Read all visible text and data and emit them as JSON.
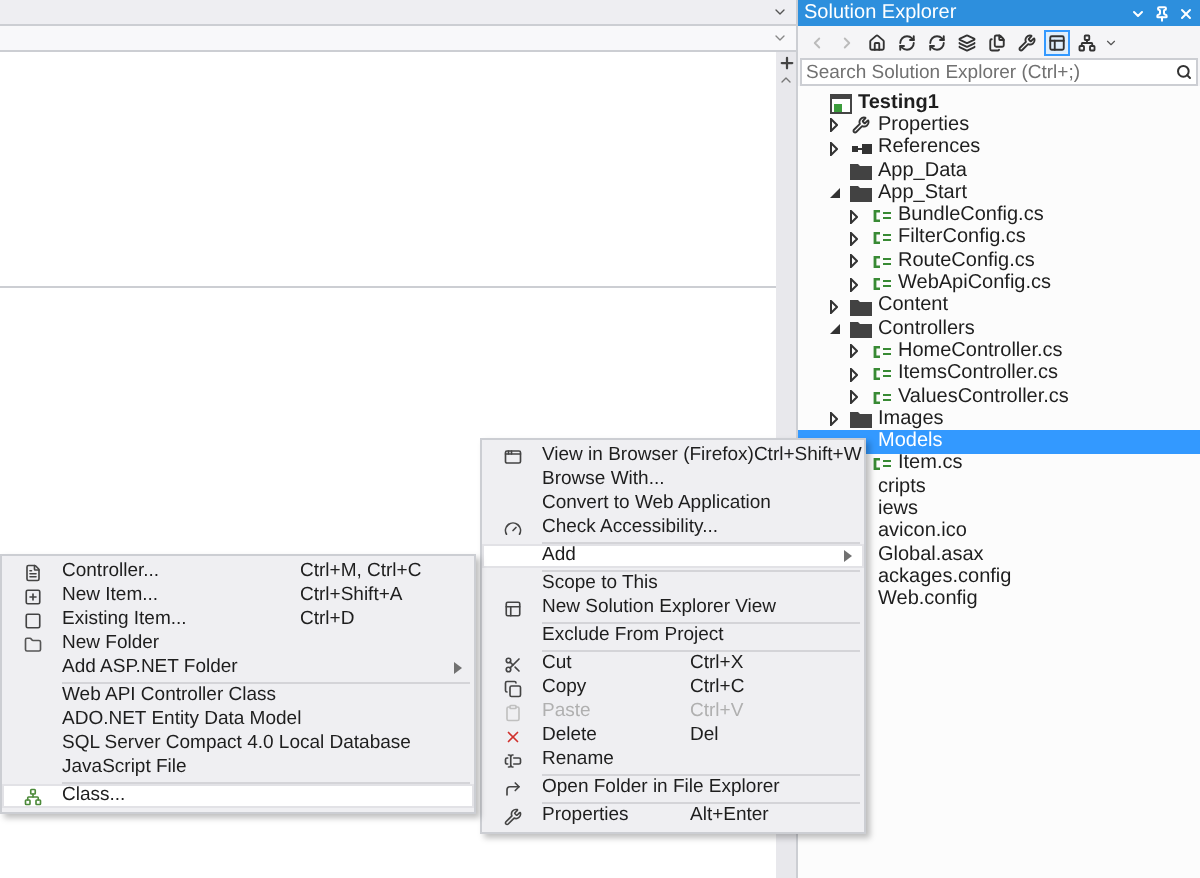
{
  "solution_explorer": {
    "title": "Solution Explorer",
    "toolbar": [
      {
        "kind": "back",
        "selected": false,
        "disabled": true
      },
      {
        "kind": "forward",
        "selected": false,
        "disabled": true
      },
      {
        "kind": "home",
        "selected": false,
        "disabled": false
      },
      {
        "kind": "sync",
        "selected": false,
        "disabled": false
      },
      {
        "kind": "refresh",
        "selected": false,
        "disabled": false
      },
      {
        "kind": "collapse",
        "selected": false,
        "disabled": false
      },
      {
        "kind": "show-all",
        "selected": false,
        "disabled": false
      },
      {
        "kind": "properties",
        "selected": false,
        "disabled": false
      },
      {
        "kind": "preview",
        "selected": true,
        "disabled": false
      },
      {
        "kind": "class-view",
        "selected": false,
        "disabled": false
      }
    ],
    "search": {
      "placeholder": "Search Solution Explorer (Ctrl+;)"
    },
    "tree": [
      {
        "label": "Testing1",
        "kind": "project",
        "selected": false,
        "children": [
          {
            "label": "Properties",
            "kind": "wrench",
            "expanded": false,
            "selected": false
          },
          {
            "label": "References",
            "kind": "references",
            "expanded": false,
            "selected": false
          },
          {
            "label": "App_Data",
            "kind": "folder",
            "selected": false
          },
          {
            "label": "App_Start",
            "kind": "folder",
            "expanded": true,
            "selected": false,
            "children": [
              {
                "label": "BundleConfig.cs",
                "kind": "cs",
                "expanded": false,
                "selected": false
              },
              {
                "label": "FilterConfig.cs",
                "kind": "cs",
                "expanded": false,
                "selected": false
              },
              {
                "label": "RouteConfig.cs",
                "kind": "cs",
                "expanded": false,
                "selected": false
              },
              {
                "label": "WebApiConfig.cs",
                "kind": "cs",
                "expanded": false,
                "selected": false
              }
            ]
          },
          {
            "label": "Content",
            "kind": "folder",
            "expanded": false,
            "selected": false
          },
          {
            "label": "Controllers",
            "kind": "folder",
            "expanded": true,
            "selected": false,
            "children": [
              {
                "label": "HomeController.cs",
                "kind": "cs",
                "expanded": false,
                "selected": false
              },
              {
                "label": "ItemsController.cs",
                "kind": "cs",
                "expanded": false,
                "selected": false
              },
              {
                "label": "ValuesController.cs",
                "kind": "cs",
                "expanded": false,
                "selected": false
              }
            ]
          },
          {
            "label": "Images",
            "kind": "folder",
            "expanded": false,
            "selected": false
          },
          {
            "label": "Models",
            "kind": "plain",
            "selected": true,
            "children": [
              {
                "label": "Item.cs",
                "kind": "cs",
                "selected": false
              }
            ]
          },
          {
            "label": "cripts",
            "kind": "plain",
            "selected": false
          },
          {
            "label": "iews",
            "kind": "plain",
            "selected": false
          },
          {
            "label": "avicon.ico",
            "kind": "plain",
            "selected": false
          },
          {
            "label": "Global.asax",
            "kind": "plain",
            "selected": false
          },
          {
            "label": "ackages.config",
            "kind": "plain",
            "selected": false
          },
          {
            "label": "Web.config",
            "kind": "plain",
            "selected": false
          }
        ]
      }
    ]
  },
  "context_menu": {
    "groups": [
      [
        {
          "kind": "browser",
          "label": "View in Browser (Firefox)",
          "shortcut": "Ctrl+Shift+W",
          "selected": false,
          "disabled": false
        },
        {
          "kind": "plain",
          "label": "Browse With...",
          "selected": false,
          "disabled": false
        },
        {
          "kind": "plain",
          "label": "Convert to Web Application",
          "selected": false,
          "disabled": false
        },
        {
          "kind": "accessibility",
          "label": "Check Accessibility...",
          "selected": false,
          "disabled": false
        }
      ],
      [
        {
          "kind": "submenu",
          "label": "Add",
          "selected": true,
          "disabled": false
        }
      ],
      [
        {
          "kind": "plain",
          "label": "Scope to This",
          "selected": false,
          "disabled": false
        },
        {
          "kind": "new-view",
          "label": "New Solution Explorer View",
          "selected": false,
          "disabled": false
        }
      ],
      [
        {
          "kind": "plain",
          "label": "Exclude From Project",
          "selected": false,
          "disabled": false
        }
      ],
      [
        {
          "kind": "cut",
          "label": "Cut",
          "shortcut": "Ctrl+X",
          "selected": false,
          "disabled": false
        },
        {
          "kind": "copy",
          "label": "Copy",
          "shortcut": "Ctrl+C",
          "selected": false,
          "disabled": false
        },
        {
          "kind": "paste",
          "label": "Paste",
          "shortcut": "Ctrl+V",
          "selected": false,
          "disabled": true
        },
        {
          "kind": "delete",
          "label": "Delete",
          "shortcut": "Del",
          "selected": false,
          "disabled": false
        },
        {
          "kind": "rename",
          "label": "Rename",
          "selected": false,
          "disabled": false
        }
      ],
      [
        {
          "kind": "open-folder",
          "label": "Open Folder in File Explorer",
          "selected": false,
          "disabled": false
        }
      ],
      [
        {
          "kind": "wrench",
          "label": "Properties",
          "shortcut": "Alt+Enter",
          "selected": false,
          "disabled": false
        }
      ]
    ]
  },
  "add_submenu": {
    "groups": [
      [
        {
          "kind": "controller",
          "label": "Controller...",
          "shortcut": "Ctrl+M, Ctrl+C",
          "selected": false,
          "disabled": false
        },
        {
          "kind": "new-item",
          "label": "New Item...",
          "shortcut": "Ctrl+Shift+A",
          "selected": false,
          "disabled": false
        },
        {
          "kind": "existing-item",
          "label": "Existing Item...",
          "shortcut": "Ctrl+D",
          "selected": false,
          "disabled": false
        },
        {
          "kind": "folder",
          "label": "New Folder",
          "selected": false,
          "disabled": false
        },
        {
          "kind": "submenu",
          "label": "Add ASP.NET Folder",
          "selected": false,
          "disabled": false
        }
      ],
      [
        {
          "kind": "plain",
          "label": "Web API Controller Class",
          "selected": false,
          "disabled": false
        },
        {
          "kind": "plain",
          "label": "ADO.NET Entity Data Model",
          "selected": false,
          "disabled": false
        },
        {
          "kind": "plain",
          "label": "SQL Server Compact 4.0 Local Database",
          "selected": false,
          "disabled": false
        },
        {
          "kind": "plain",
          "label": "JavaScript File",
          "selected": false,
          "disabled": false
        }
      ],
      [
        {
          "kind": "class",
          "label": "Class...",
          "selected": true,
          "disabled": false
        }
      ]
    ]
  }
}
